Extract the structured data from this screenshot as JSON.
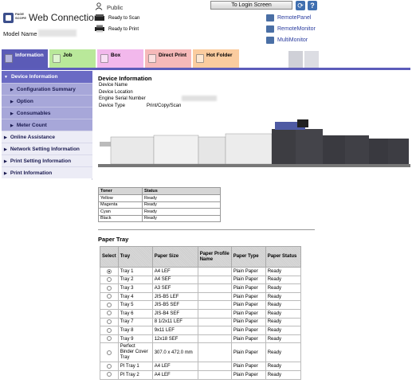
{
  "header": {
    "logo_small": "PAGE SCOPE",
    "logo_title": "Web Connection",
    "model_label": "Model Name",
    "user_name": "Public",
    "status_scan": "Ready to Scan",
    "status_print": "Ready to Print",
    "login_button": "To Login Screen",
    "refresh_glyph": "⟳",
    "help_glyph": "?",
    "links": [
      "RemotePanel",
      "RemoteMonitor",
      "MultiMonitor"
    ]
  },
  "tabs": [
    {
      "label": "Information",
      "color": "#5b5bb7",
      "selected": true
    },
    {
      "label": "Job",
      "color": "#b9e89a"
    },
    {
      "label": "Box",
      "color": "#f2b8ec"
    },
    {
      "label": "Direct Print",
      "color": "#f6b9b9"
    },
    {
      "label": "Hot Folder",
      "color": "#fbcc9f"
    }
  ],
  "sidebar": {
    "items": [
      {
        "label": "Device Information",
        "level": "main",
        "expanded": true
      },
      {
        "label": "Configuration Summary",
        "level": "sub"
      },
      {
        "label": "Option",
        "level": "sub"
      },
      {
        "label": "Consumables",
        "level": "sub"
      },
      {
        "label": "Meter Count",
        "level": "sub"
      },
      {
        "label": "Online Assistance",
        "level": "top"
      },
      {
        "label": "Network Setting Information",
        "level": "top"
      },
      {
        "label": "Print Setting Information",
        "level": "top"
      },
      {
        "label": "Print Information",
        "level": "top"
      }
    ]
  },
  "device_info": {
    "title": "Device Information",
    "fields": [
      "Device Name",
      "Device Location",
      "Engine Serial Number",
      "Device Type"
    ],
    "device_type_value": "Print/Copy/Scan"
  },
  "toner": {
    "headers": [
      "Toner",
      "Status"
    ],
    "rows": [
      [
        "Yellow",
        "Ready"
      ],
      [
        "Magenta",
        "Ready"
      ],
      [
        "Cyan",
        "Ready"
      ],
      [
        "Black",
        "Ready"
      ]
    ]
  },
  "paper_tray": {
    "title": "Paper Tray",
    "headers": [
      "Select",
      "Tray",
      "Paper Size",
      "Paper Profile Name",
      "Paper Type",
      "Paper Status"
    ],
    "rows": [
      {
        "selected": true,
        "tray": "Tray 1",
        "size": "A4 LEF",
        "profile": "",
        "type": "Plain Paper",
        "status": "Ready"
      },
      {
        "selected": false,
        "tray": "Tray 2",
        "size": "A4 SEF",
        "profile": "",
        "type": "Plain Paper",
        "status": "Ready"
      },
      {
        "selected": false,
        "tray": "Tray 3",
        "size": "A3 SEF",
        "profile": "",
        "type": "Plain Paper",
        "status": "Ready"
      },
      {
        "selected": false,
        "tray": "Tray 4",
        "size": "JIS-B5 LEF",
        "profile": "",
        "type": "Plain Paper",
        "status": "Ready"
      },
      {
        "selected": false,
        "tray": "Tray 5",
        "size": "JIS-B5 SEF",
        "profile": "",
        "type": "Plain Paper",
        "status": "Ready"
      },
      {
        "selected": false,
        "tray": "Tray 6",
        "size": "JIS-B4 SEF",
        "profile": "",
        "type": "Plain Paper",
        "status": "Ready"
      },
      {
        "selected": false,
        "tray": "Tray 7",
        "size": "8 1/2x11 LEF",
        "profile": "",
        "type": "Plain Paper",
        "status": "Ready"
      },
      {
        "selected": false,
        "tray": "Tray 8",
        "size": "9x11 LEF",
        "profile": "",
        "type": "Plain Paper",
        "status": "Ready"
      },
      {
        "selected": false,
        "tray": "Tray 9",
        "size": "12x18 SEF",
        "profile": "",
        "type": "Plain Paper",
        "status": "Ready"
      },
      {
        "selected": false,
        "tray": "Perfect Binder Cover Tray",
        "size": "307.0 x 472.0 mm",
        "profile": "",
        "type": "Plain Paper",
        "status": "Ready"
      },
      {
        "selected": false,
        "tray": "PI Tray 1",
        "size": "A4 LEF",
        "profile": "",
        "type": "Plain Paper",
        "status": "Ready"
      },
      {
        "selected": false,
        "tray": "PI Tray 2",
        "size": "A4 LEF",
        "profile": "",
        "type": "Plain Paper",
        "status": "Ready"
      }
    ]
  }
}
